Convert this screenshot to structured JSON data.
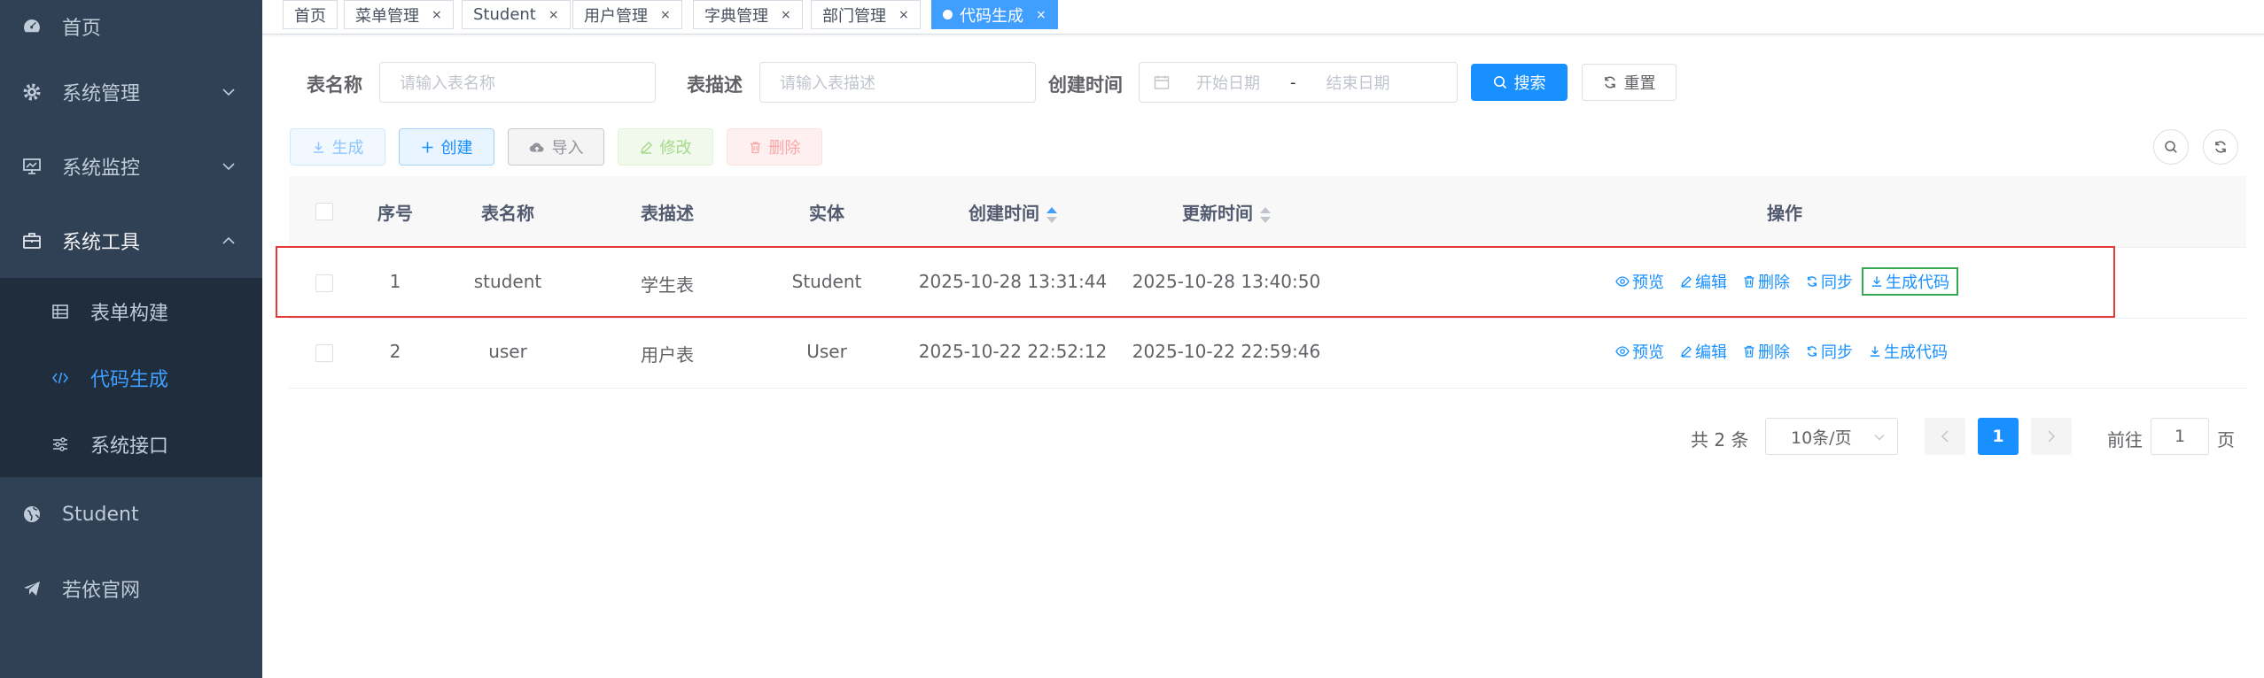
{
  "sidebar": {
    "items": [
      {
        "label": "首页"
      },
      {
        "label": "系统管理"
      },
      {
        "label": "系统监控"
      },
      {
        "label": "系统工具"
      },
      {
        "label": "Student"
      },
      {
        "label": "若依官网"
      }
    ],
    "submenu": [
      {
        "label": "表单构建"
      },
      {
        "label": "代码生成"
      },
      {
        "label": "系统接口"
      }
    ]
  },
  "tags": [
    {
      "label": "首页"
    },
    {
      "label": "菜单管理"
    },
    {
      "label": "Student"
    },
    {
      "label": "用户管理"
    },
    {
      "label": "字典管理"
    },
    {
      "label": "部门管理"
    },
    {
      "label": "代码生成"
    }
  ],
  "search": {
    "table_name_label": "表名称",
    "table_name_placeholder": "请输入表名称",
    "table_desc_label": "表描述",
    "table_desc_placeholder": "请输入表描述",
    "create_time_label": "创建时间",
    "start_date_placeholder": "开始日期",
    "range_separator": "-",
    "end_date_placeholder": "结束日期",
    "search_btn": "搜索",
    "reset_btn": "重置"
  },
  "toolbar": {
    "generate": "生成",
    "create": "创建",
    "import": "导入",
    "edit": "修改",
    "delete": "删除"
  },
  "table": {
    "headers": [
      "序号",
      "表名称",
      "表描述",
      "实体",
      "创建时间",
      "更新时间",
      "操作"
    ],
    "rows": [
      {
        "index": "1",
        "name": "student",
        "desc": "学生表",
        "entity": "Student",
        "created": "2025-10-28 13:31:44",
        "updated": "2025-10-28 13:40:50"
      },
      {
        "index": "2",
        "name": "user",
        "desc": "用户表",
        "entity": "User",
        "created": "2025-10-22 22:52:12",
        "updated": "2025-10-22 22:59:46"
      }
    ],
    "ops": {
      "preview": "预览",
      "edit": "编辑",
      "delete": "删除",
      "sync": "同步",
      "gencode": "生成代码"
    }
  },
  "pagination": {
    "total": "共 2 条",
    "page_size": "10条/页",
    "current": "1",
    "goto_prefix": "前往",
    "goto_value": "1",
    "goto_suffix": "页"
  },
  "colors": {
    "sidebar_bg": "#304156",
    "submenu_bg": "#1f2d3d",
    "primary": "#1890ff",
    "highlight_box": "#e53935",
    "outline_box": "#34a853"
  }
}
